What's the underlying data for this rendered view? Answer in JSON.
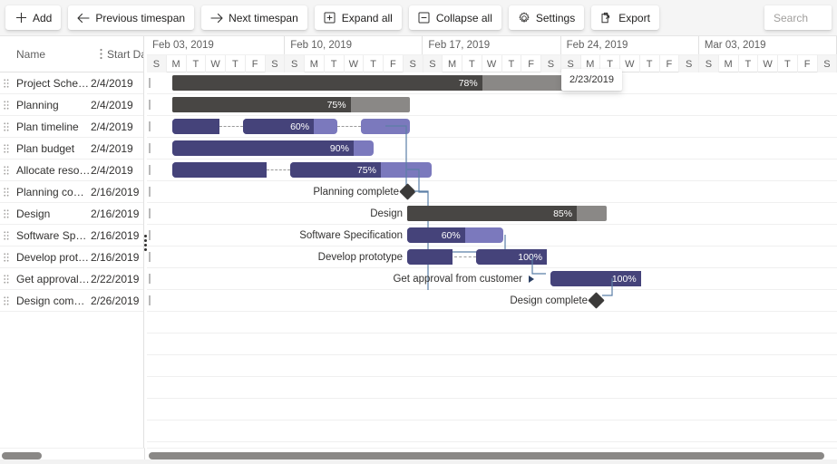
{
  "toolbar": {
    "buttons": [
      {
        "label": "Add",
        "icon": "plus-icon"
      },
      {
        "label": "Previous timespan",
        "icon": "arrow-left-icon"
      },
      {
        "label": "Next timespan",
        "icon": "arrow-right-icon"
      },
      {
        "label": "Expand all",
        "icon": "expand-all-icon"
      },
      {
        "label": "Collapse all",
        "icon": "collapse-all-icon"
      },
      {
        "label": "Settings",
        "icon": "gear-icon"
      },
      {
        "label": "Export",
        "icon": "export-icon"
      }
    ],
    "search_placeholder": "Search"
  },
  "grid": {
    "columns": [
      "Name",
      "Start Date"
    ],
    "rows": [
      {
        "name": "Project Schedule",
        "start": "2/4/2019"
      },
      {
        "name": "Planning",
        "start": "2/4/2019"
      },
      {
        "name": "Plan timeline",
        "start": "2/4/2019"
      },
      {
        "name": "Plan budget",
        "start": "2/4/2019"
      },
      {
        "name": "Allocate resources",
        "start": "2/4/2019"
      },
      {
        "name": "Planning complete",
        "start": "2/16/2019"
      },
      {
        "name": "Design",
        "start": "2/16/2019"
      },
      {
        "name": "Software Specification",
        "start": "2/16/2019"
      },
      {
        "name": "Develop prototype",
        "start": "2/16/2019"
      },
      {
        "name": "Get approval from cu...",
        "start": "2/22/2019"
      },
      {
        "name": "Design complete",
        "start": "2/26/2019"
      }
    ]
  },
  "timeline": {
    "weeks": [
      "Feb 03, 2019",
      "Feb 10, 2019",
      "Feb 17, 2019",
      "Feb 24, 2019",
      "Mar 03, 2019"
    ],
    "days": [
      "S",
      "M",
      "T",
      "W",
      "T",
      "F",
      "S"
    ],
    "tooltip": "2/23/2019",
    "colors": {
      "summary_progress": "#484644",
      "summary_remainder": "#8a8886",
      "task_progress": "#45437a",
      "task_remainder": "#7b79bd",
      "milestone": "#3b3a39",
      "dependency_line": "#5b7fa6"
    },
    "tasks": [
      {
        "name": "Project Schedule",
        "type": "summary",
        "progress": "78%",
        "label": ""
      },
      {
        "name": "Planning",
        "type": "summary",
        "progress": "75%",
        "label": ""
      },
      {
        "name": "Plan timeline",
        "type": "task",
        "progress": "60%",
        "label": ""
      },
      {
        "name": "Plan budget",
        "type": "task",
        "progress": "90%",
        "label": ""
      },
      {
        "name": "Allocate resources",
        "type": "task",
        "progress": "75%",
        "label": ""
      },
      {
        "name": "Planning complete",
        "type": "milestone",
        "progress": "",
        "label": "Planning complete"
      },
      {
        "name": "Design",
        "type": "summary",
        "progress": "85%",
        "label": "Design"
      },
      {
        "name": "Software Specification",
        "type": "task",
        "progress": "60%",
        "label": "Software Specification"
      },
      {
        "name": "Develop prototype",
        "type": "task",
        "progress": "100%",
        "label": "Develop prototype"
      },
      {
        "name": "Get approval from customer",
        "type": "task",
        "progress": "100%",
        "label": "Get approval from customer"
      },
      {
        "name": "Design complete",
        "type": "milestone",
        "progress": "",
        "label": "Design complete"
      }
    ]
  }
}
